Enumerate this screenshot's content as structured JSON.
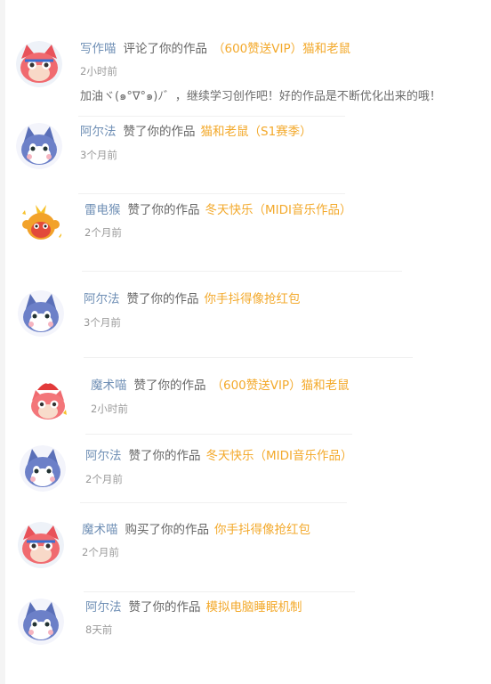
{
  "notifications": [
    {
      "user": "写作喵",
      "action": "评论了你的作品",
      "work": "（600赞送VIP）猫和老鼠",
      "time": "2小时前",
      "comment": "加油ヾ(๑°∇°๑)ﾉ゛，继续学习创作吧！好的作品是不断优化出来的哦！",
      "avatar": "red-cat"
    },
    {
      "user": "阿尔法",
      "action": "赞了你的作品",
      "work": "猫和老鼠（S1赛季）",
      "time": "3个月前",
      "avatar": "blue-cat"
    },
    {
      "user": "雷电猴",
      "action": "赞了你的作品",
      "work": "冬天快乐（MIDI音乐作品）",
      "time": "2个月前",
      "avatar": "monkey"
    },
    {
      "user": "阿尔法",
      "action": "赞了你的作品",
      "work": "你手抖得像抢红包",
      "time": "3个月前",
      "avatar": "blue-cat"
    },
    {
      "user": "魔术喵",
      "action": "赞了你的作品",
      "work": "（600赞送VIP）猫和老鼠",
      "time": "2小时前",
      "avatar": "magic-cat"
    },
    {
      "user": "阿尔法",
      "action": "赞了你的作品",
      "work": "冬天快乐（MIDI音乐作品）",
      "time": "2个月前",
      "avatar": "blue-cat"
    },
    {
      "user": "魔术喵",
      "action": "购买了你的作品",
      "work": "你手抖得像抢红包",
      "time": "2个月前",
      "avatar": "red-cat"
    },
    {
      "user": "阿尔法",
      "action": "赞了你的作品",
      "work": "模拟电脑睡眠机制",
      "time": "8天前",
      "avatar": "blue-cat"
    }
  ]
}
